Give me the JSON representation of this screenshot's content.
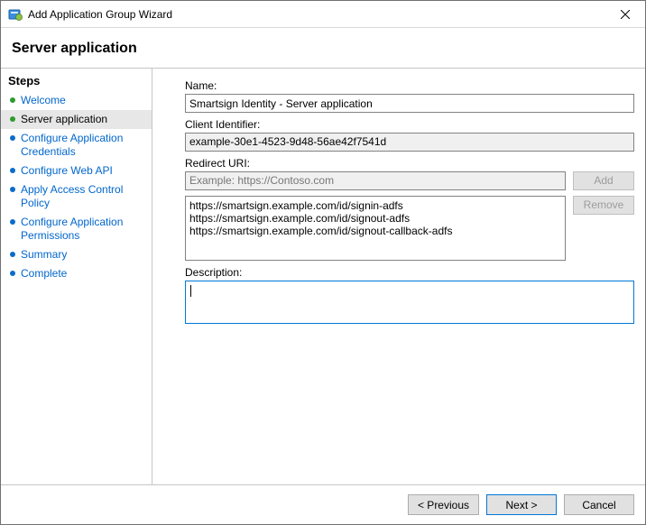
{
  "window": {
    "title": "Add Application Group Wizard"
  },
  "header": "Server application",
  "sidebar": {
    "heading": "Steps",
    "items": [
      {
        "label": "Welcome",
        "state": "done"
      },
      {
        "label": "Server application",
        "state": "current"
      },
      {
        "label": "Configure Application Credentials",
        "state": "pending"
      },
      {
        "label": "Configure Web API",
        "state": "pending"
      },
      {
        "label": "Apply Access Control Policy",
        "state": "pending"
      },
      {
        "label": "Configure Application Permissions",
        "state": "pending"
      },
      {
        "label": "Summary",
        "state": "pending"
      },
      {
        "label": "Complete",
        "state": "pending"
      }
    ]
  },
  "form": {
    "name_label": "Name:",
    "name_value": "Smartsign Identity - Server application",
    "client_id_label": "Client Identifier:",
    "client_id_value": "example-30e1-4523-9d48-56ae42f7541d",
    "redirect_label": "Redirect URI:",
    "redirect_placeholder": "Example: https://Contoso.com",
    "redirect_input_value": "",
    "add_button": "Add",
    "remove_button": "Remove",
    "redirect_uris": [
      "https://smartsign.example.com/id/signin-adfs",
      "https://smartsign.example.com/id/signout-adfs",
      "https://smartsign.example.com/id/signout-callback-adfs"
    ],
    "description_label": "Description:",
    "description_value": ""
  },
  "footer": {
    "previous": "< Previous",
    "next": "Next >",
    "cancel": "Cancel"
  }
}
